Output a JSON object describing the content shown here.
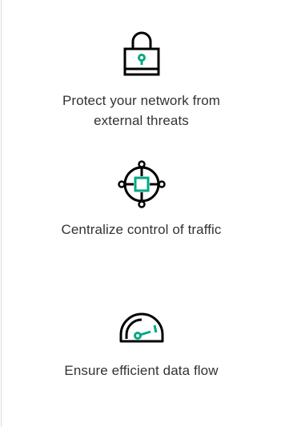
{
  "colors": {
    "accent": "#01A982",
    "icon": "#000000",
    "text": "#333333",
    "divider": "#DCDCDC"
  },
  "features": [
    {
      "icon": "padlock-icon",
      "caption_lines": [
        "Protect your network from",
        "external threats"
      ]
    },
    {
      "icon": "crosshair-network-icon",
      "caption_lines": [
        "Centralize control of traffic"
      ]
    },
    {
      "icon": "speedometer-icon",
      "caption_lines": [
        "Ensure efficient data flow"
      ]
    }
  ]
}
